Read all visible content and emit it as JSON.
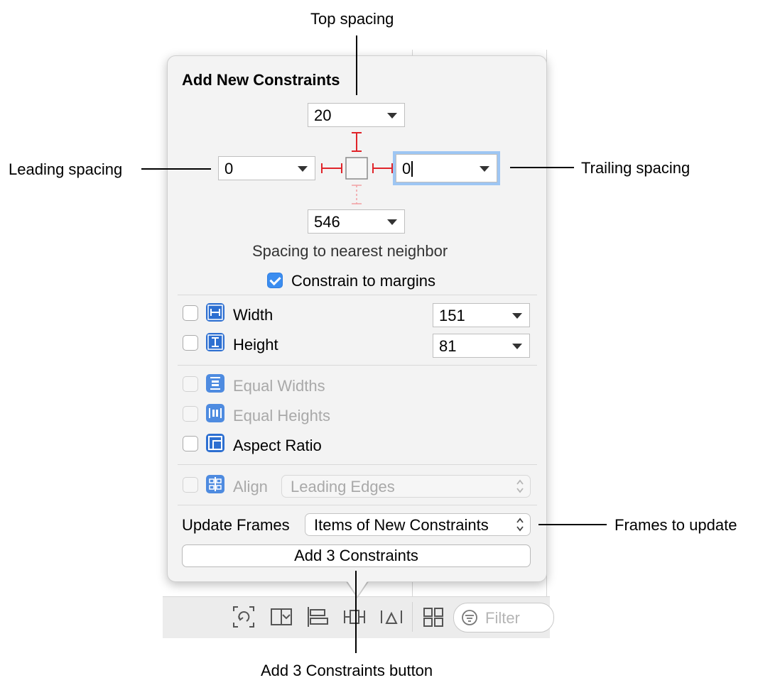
{
  "callouts": {
    "top_spacing": "Top spacing",
    "leading_spacing": "Leading spacing",
    "trailing_spacing": "Trailing spacing",
    "frames_to_update": "Frames to update",
    "add_button": "Add 3 Constraints button"
  },
  "popover": {
    "title": "Add New Constraints",
    "spacing": {
      "top": "20",
      "leading": "0",
      "trailing": "0",
      "bottom": "546",
      "caption": "Spacing to nearest neighbor"
    },
    "constrain_to_margins": {
      "label": "Constrain to margins",
      "checked": true
    },
    "size": [
      {
        "label": "Width",
        "value": "151",
        "checked": false
      },
      {
        "label": "Height",
        "value": "81",
        "checked": false
      }
    ],
    "equal": [
      {
        "label": "Equal Widths",
        "enabled": false
      },
      {
        "label": "Equal Heights",
        "enabled": false
      },
      {
        "label": "Aspect Ratio",
        "enabled": true
      }
    ],
    "align": {
      "label": "Align",
      "value": "Leading Edges",
      "enabled": false
    },
    "update_frames": {
      "label": "Update Frames",
      "value": "Items of New Constraints"
    },
    "add_button_label": "Add 3 Constraints"
  },
  "toolbar": {
    "filter_placeholder": "Filter",
    "icons": [
      "update-frames-icon",
      "embed-in-stack-icon",
      "align-icon",
      "add-constraints-icon",
      "resolve-issues-icon",
      "grid-icon",
      "filter-icon"
    ]
  },
  "colors": {
    "constraint_red": "#e0242a",
    "focus_ring": "#9ec6f3",
    "checkbox_accent": "#3b8df0",
    "icon_blue": "#2d6fd1"
  }
}
